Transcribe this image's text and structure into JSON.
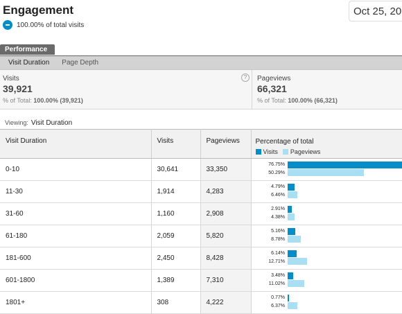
{
  "header": {
    "title": "Engagement",
    "subtitle": "100.00% of total visits",
    "date": "Oct 25, 20"
  },
  "tabs": {
    "performance": "Performance",
    "subtabs": [
      "Visit Duration",
      "Page Depth"
    ]
  },
  "summary": {
    "visits": {
      "label": "Visits",
      "value": "39,921",
      "prefix": "% of Total:",
      "total": "100.00% (39,921)"
    },
    "pageviews": {
      "label": "Pageviews",
      "value": "66,321",
      "prefix": "% of Total:",
      "total": "100.00% (66,321)"
    }
  },
  "viewing": {
    "label": "Viewing:",
    "value": "Visit Duration"
  },
  "table": {
    "headers": [
      "Visit Duration",
      "Visits",
      "Pageviews",
      "Percentage of total"
    ],
    "legend": [
      "Visits",
      "Pageviews"
    ],
    "colors": {
      "visits": "#058dc7",
      "pageviews": "#aadff3"
    },
    "rows": [
      {
        "duration": "0-10",
        "visits": "30,641",
        "pageviews": "33,350",
        "visits_pct": "76.75%",
        "pageviews_pct": "50.29%",
        "visits_frac": 0.7675,
        "pageviews_frac": 0.5029
      },
      {
        "duration": "11-30",
        "visits": "1,914",
        "pageviews": "4,283",
        "visits_pct": "4.79%",
        "pageviews_pct": "6.46%",
        "visits_frac": 0.0479,
        "pageviews_frac": 0.0646
      },
      {
        "duration": "31-60",
        "visits": "1,160",
        "pageviews": "2,908",
        "visits_pct": "2.91%",
        "pageviews_pct": "4.38%",
        "visits_frac": 0.0291,
        "pageviews_frac": 0.0438
      },
      {
        "duration": "61-180",
        "visits": "2,059",
        "pageviews": "5,820",
        "visits_pct": "5.16%",
        "pageviews_pct": "8.78%",
        "visits_frac": 0.0516,
        "pageviews_frac": 0.0878
      },
      {
        "duration": "181-600",
        "visits": "2,450",
        "pageviews": "8,428",
        "visits_pct": "6.14%",
        "pageviews_pct": "12.71%",
        "visits_frac": 0.0614,
        "pageviews_frac": 0.1271
      },
      {
        "duration": "601-1800",
        "visits": "1,389",
        "pageviews": "7,310",
        "visits_pct": "3.48%",
        "pageviews_pct": "11.02%",
        "visits_frac": 0.0348,
        "pageviews_frac": 0.1102
      },
      {
        "duration": "1801+",
        "visits": "308",
        "pageviews": "4,222",
        "visits_pct": "0.77%",
        "pageviews_pct": "6.37%",
        "visits_frac": 0.0077,
        "pageviews_frac": 0.0637
      }
    ]
  }
}
